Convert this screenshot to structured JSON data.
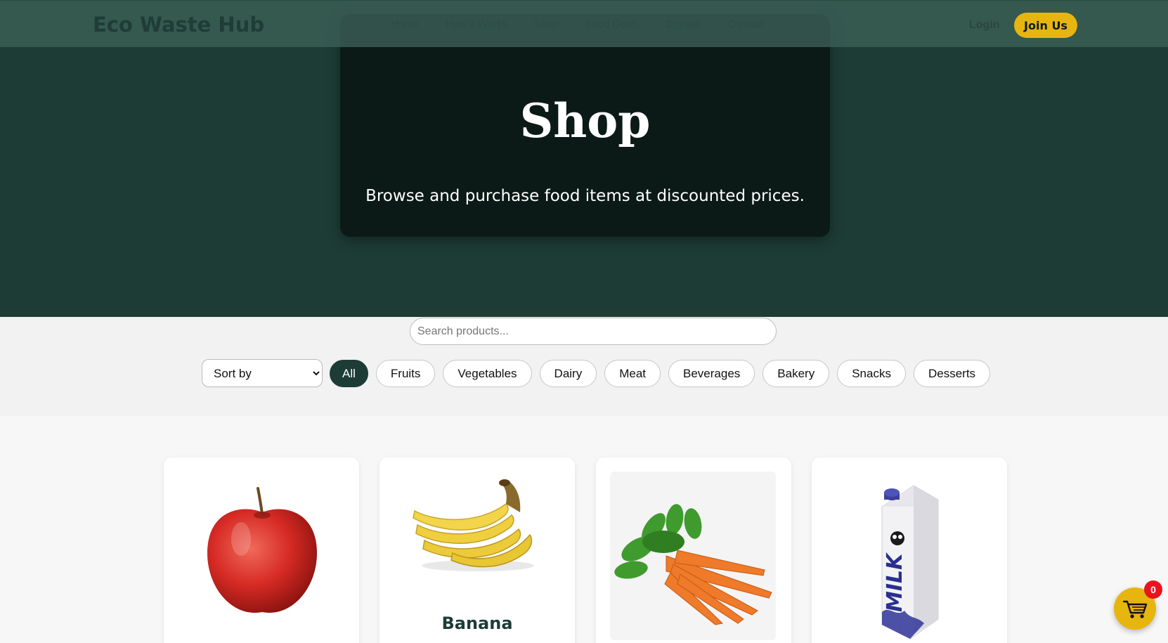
{
  "nav": {
    "brand": "Eco Waste Hub",
    "links": [
      "Home",
      "How it Works",
      "Shop",
      "Food Deals",
      "Donate",
      "Contact"
    ],
    "login": "Login",
    "join": "Join Us"
  },
  "hero": {
    "title": "Shop",
    "subtitle": "Browse and purchase food items at discounted prices."
  },
  "filters": {
    "search_placeholder": "Search products...",
    "sort_label": "Sort by",
    "categories": [
      "All",
      "Fruits",
      "Vegetables",
      "Dairy",
      "Meat",
      "Beverages",
      "Bakery",
      "Snacks",
      "Desserts"
    ],
    "active_category": "All"
  },
  "products": [
    {
      "name": "",
      "image": "red-apple"
    },
    {
      "name": "Banana",
      "image": "banana-bunch"
    },
    {
      "name": "",
      "image": "carrot-bunch"
    },
    {
      "name": "",
      "image": "milk-carton",
      "carton_text": "MILK"
    }
  ],
  "cart": {
    "count": "0",
    "icon": "shopping-cart-icon"
  },
  "colors": {
    "primary": "#1d3c35",
    "accent": "#e6b510",
    "badge": "#e8141d"
  }
}
